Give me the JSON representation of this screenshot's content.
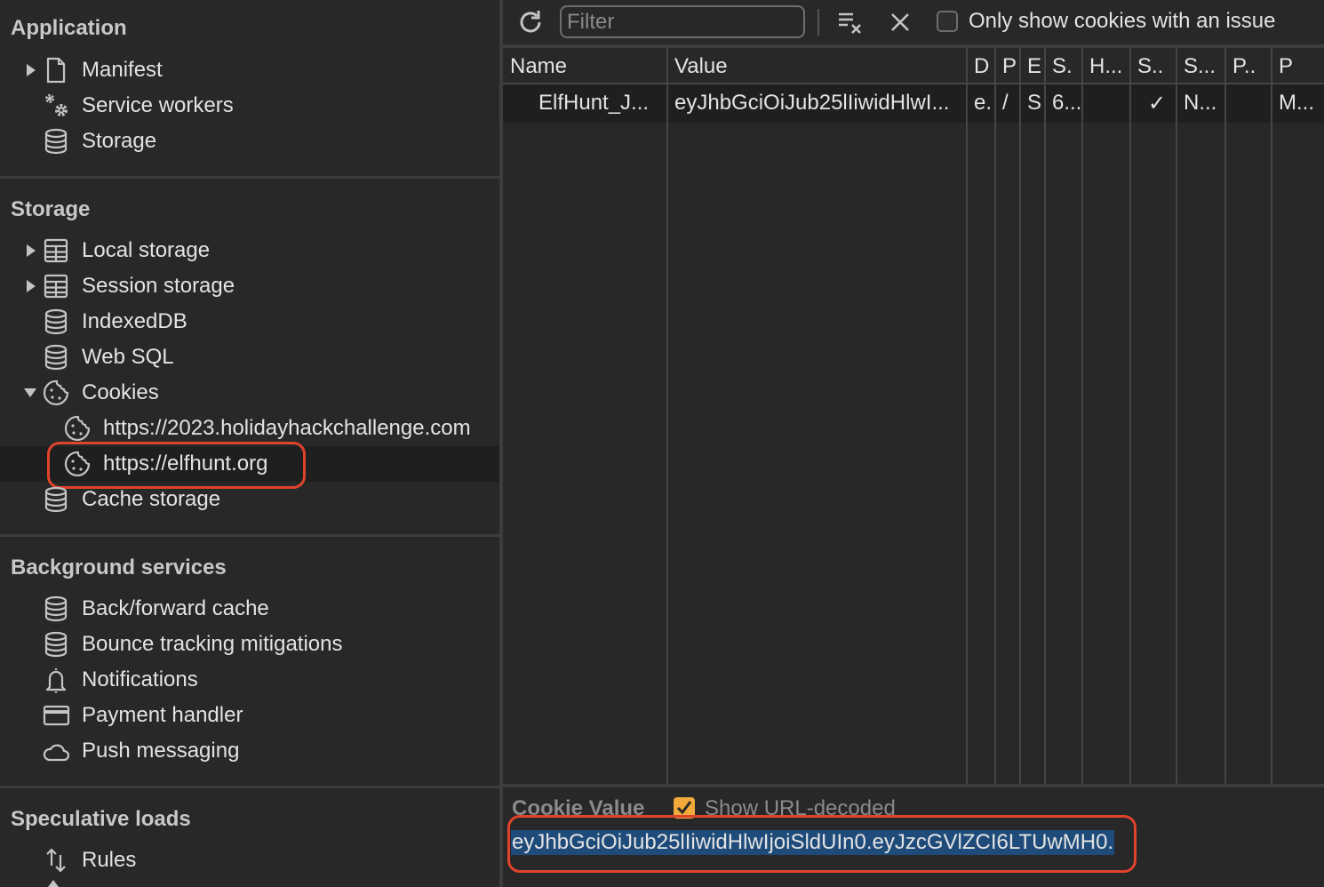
{
  "sidebar": {
    "sections": [
      {
        "title": "Application",
        "items": [
          {
            "label": "Manifest",
            "icon": "document-icon",
            "expandable": true,
            "expanded": false
          },
          {
            "label": "Service workers",
            "icon": "gears-icon",
            "expandable": false
          },
          {
            "label": "Storage",
            "icon": "database-icon",
            "expandable": false
          }
        ]
      },
      {
        "title": "Storage",
        "items": [
          {
            "label": "Local storage",
            "icon": "table-icon",
            "expandable": true,
            "expanded": false
          },
          {
            "label": "Session storage",
            "icon": "table-icon",
            "expandable": true,
            "expanded": false
          },
          {
            "label": "IndexedDB",
            "icon": "database-icon",
            "expandable": false
          },
          {
            "label": "Web SQL",
            "icon": "database-icon",
            "expandable": false
          },
          {
            "label": "Cookies",
            "icon": "cookie-icon",
            "expandable": true,
            "expanded": true,
            "children": [
              {
                "label": "https://2023.holidayhackchallenge.com",
                "icon": "cookie-icon",
                "selected": false
              },
              {
                "label": "https://elfhunt.org",
                "icon": "cookie-icon",
                "selected": true
              }
            ]
          },
          {
            "label": "Cache storage",
            "icon": "database-icon",
            "expandable": false
          }
        ]
      },
      {
        "title": "Background services",
        "items": [
          {
            "label": "Back/forward cache",
            "icon": "database-icon"
          },
          {
            "label": "Bounce tracking mitigations",
            "icon": "database-icon"
          },
          {
            "label": "Notifications",
            "icon": "bell-icon"
          },
          {
            "label": "Payment handler",
            "icon": "credit-card-icon"
          },
          {
            "label": "Push messaging",
            "icon": "cloud-icon"
          }
        ]
      },
      {
        "title": "Speculative loads",
        "items": [
          {
            "label": "Rules",
            "icon": "up-down-arrows-icon"
          }
        ]
      }
    ]
  },
  "toolbar": {
    "refresh_icon": "refresh-icon",
    "filter_placeholder": "Filter",
    "filter_value": "",
    "clear_filtered_icon": "clear-filtered-cookies-icon",
    "clear_all_icon": "close-icon",
    "only_issues_label": "Only show cookies with an issue",
    "only_issues_checked": false
  },
  "table": {
    "columns": [
      "Name",
      "Value",
      "D",
      "P",
      "E",
      "S.",
      "H...",
      "S..",
      "S...",
      "P..",
      "P"
    ],
    "rows": [
      {
        "cells": [
          "ElfHunt_J...",
          "eyJhbGciOiJub25lIiwidHlwI...",
          "e.",
          "/",
          "S",
          "6...",
          "",
          "✓",
          "N...",
          "",
          "M..."
        ],
        "selected": true
      }
    ]
  },
  "cookie_value": {
    "title": "Cookie Value",
    "show_decoded_label": "Show URL-decoded",
    "show_decoded_checked": true,
    "value": "eyJhbGciOiJub25lIiwidHlwIjoiSldUIn0.eyJzcGVlZCI6LTUwMH0."
  },
  "colors": {
    "annotation_ring": "#e0432c",
    "selection_bg": "#1e4b7a",
    "checkbox_accent": "#f0a93a"
  }
}
